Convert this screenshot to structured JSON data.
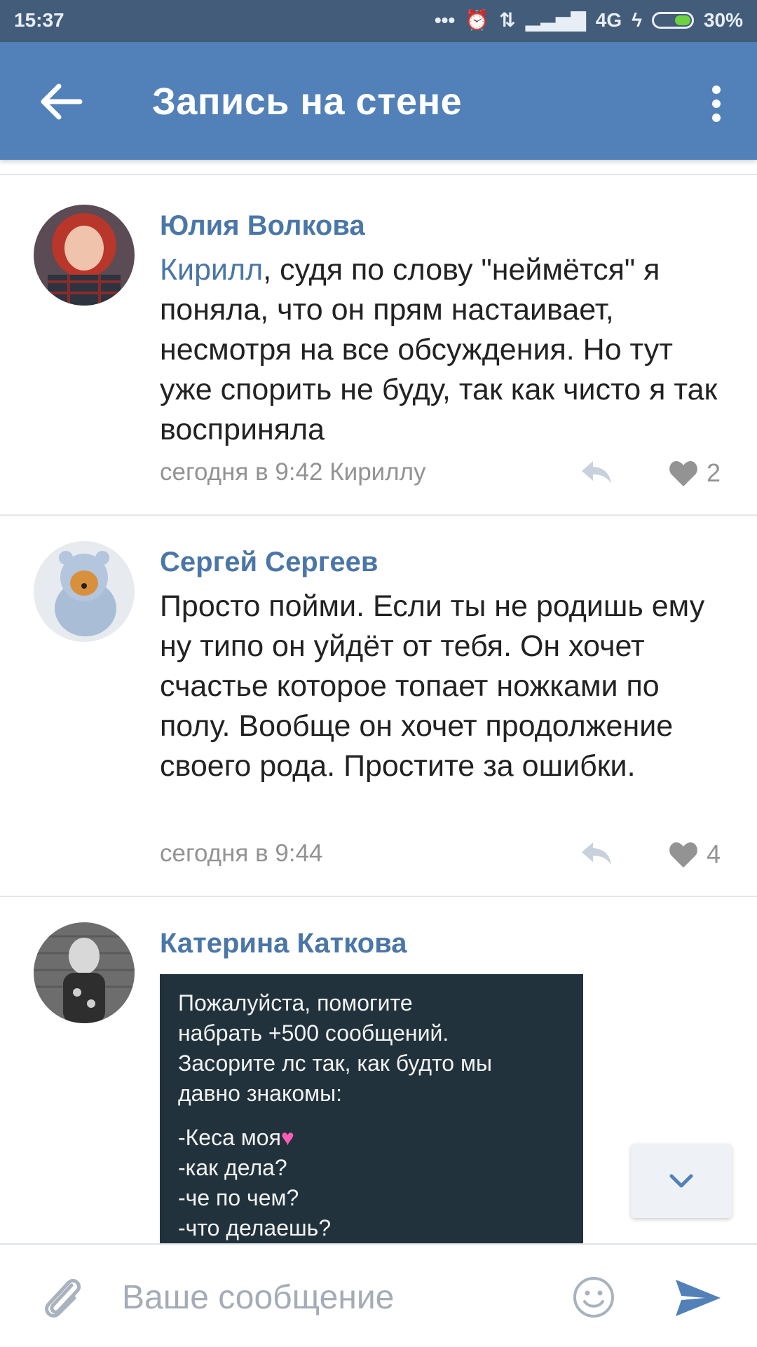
{
  "status_bar": {
    "time": "15:37",
    "network": "4G",
    "battery": "30%"
  },
  "app_bar": {
    "title": "Запись на стене"
  },
  "comments": [
    {
      "author": "Юлия Волкова",
      "mention": "Кирилл",
      "text": ", судя по слову \"неймётся\" я поняла, что он прям настаивает, несмотря на все обсуждения. Но тут уже спорить не буду, так как чисто я так восприняла",
      "meta": "сегодня в 9:42 Кириллу",
      "likes": "2"
    },
    {
      "author": "Сергей Сергеев",
      "text": "Просто пойми. Если ты не родишь ему ну типо он уйдёт от тебя. Он хочет счастье которое топает ножками по полу. Вообще он хочет продолжение своего рода. Простите за ошибки.",
      "meta": "сегодня в 9:44",
      "likes": "4"
    },
    {
      "author": "Катерина Каткова",
      "image_lines": [
        "Пожалуйста, помогите",
        "набрать +500 сообщений.",
        "Засорите лс так, как будто мы",
        "давно знакомы:",
        "-Кеса моя",
        "-как дела?",
        "-че по чем?",
        "-что делаешь?"
      ]
    }
  ],
  "composer": {
    "placeholder": "Ваше сообщение"
  },
  "colors": {
    "brand": "#5181b8",
    "link": "#4a76a8",
    "status_bar": "#435c7a"
  }
}
